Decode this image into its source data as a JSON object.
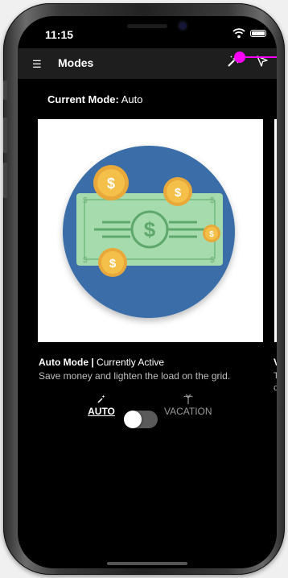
{
  "status_bar": {
    "time": "11:15"
  },
  "app_bar": {
    "title": "Modes",
    "menu_icon": "hamburger-icon",
    "wand_icon": "magic-wand-icon",
    "tour_icon": "tour-icon"
  },
  "current_mode": {
    "label": "Current Mode:",
    "value": "Auto"
  },
  "carousel": {
    "active": {
      "name": "Auto Mode |",
      "status": "Currently Active",
      "description": "Save money and lighten the load on the grid."
    },
    "next": {
      "name": "V",
      "description_lines": [
        "T",
        "c"
      ]
    }
  },
  "mode_toggle": {
    "left_label": "AUTO",
    "left_icon": "magic-wand-icon",
    "right_label": "VACATION",
    "right_icon": "palm-tree-icon",
    "state": "auto"
  },
  "colors": {
    "background": "#000000",
    "app_bar": "#1e1e1e",
    "illustration_circle": "#3a6ea8",
    "bill": "#a6dbad",
    "coin": "#f4c04a",
    "touch_indicator": "#ff00ff"
  }
}
